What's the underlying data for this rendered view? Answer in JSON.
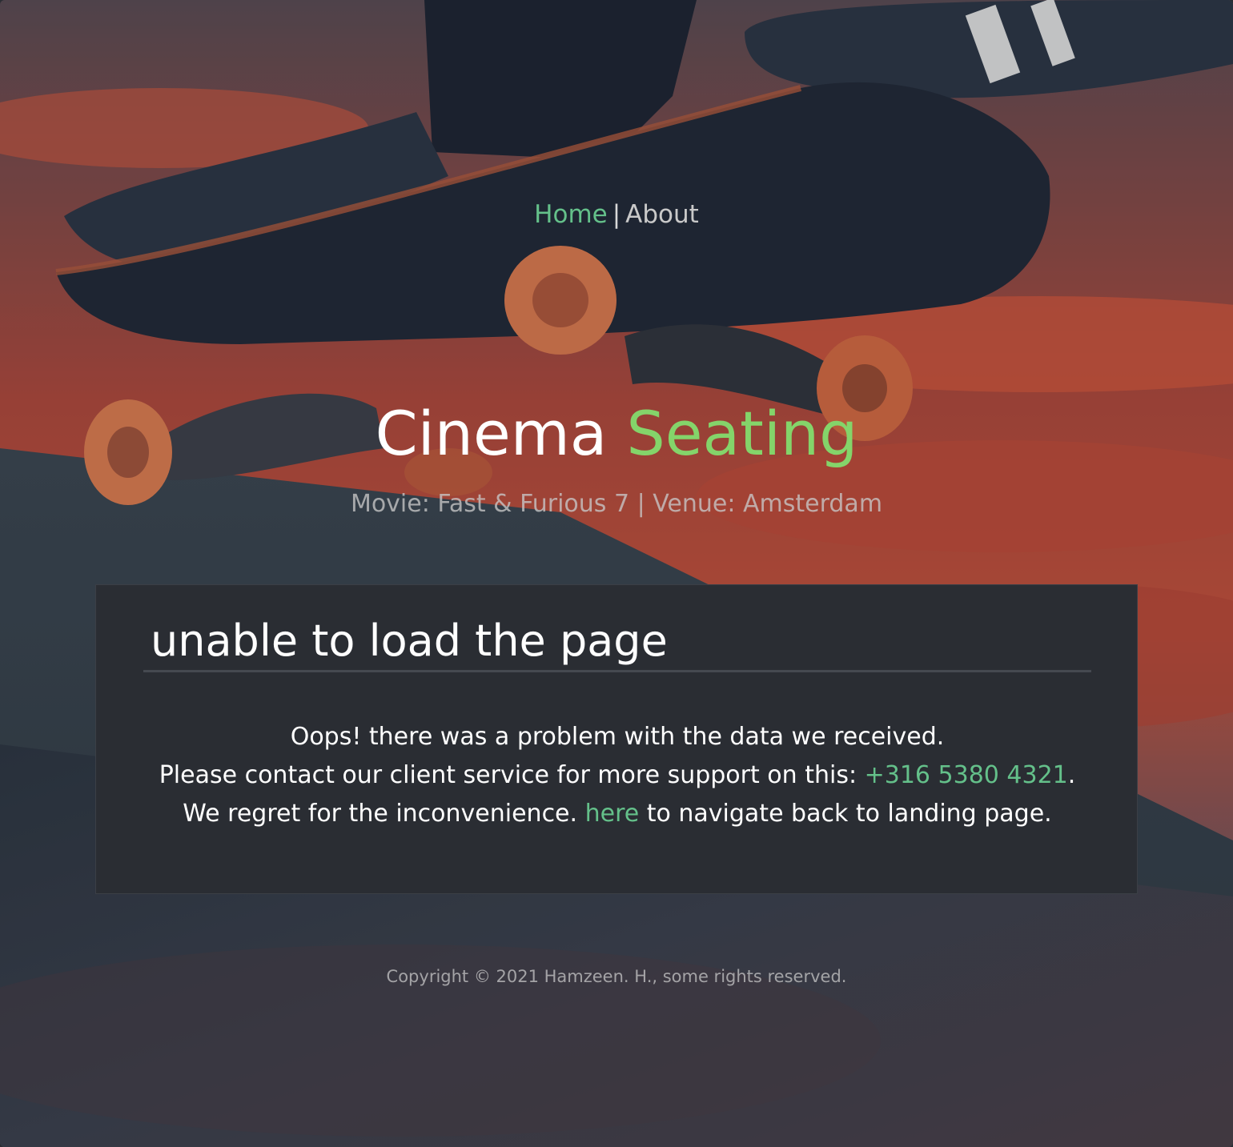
{
  "nav": {
    "home_label": "Home",
    "separator": "|",
    "about_label": "About"
  },
  "hero": {
    "title_part1": "Cinema",
    "title_part2": "Seating",
    "subtitle": "Movie: Fast & Furious 7 | Venue: Amsterdam"
  },
  "error_card": {
    "heading": "unable to load the page",
    "line1": "Oops! there was a problem with the data we received.",
    "line2_prefix": "Please contact our client service for more support on this: ",
    "phone": "+316 5380 4321",
    "line2_suffix": ".",
    "line3_prefix": "We regret for the inconvenience. ",
    "here_link": "here",
    "line3_suffix": " to navigate back to landing page."
  },
  "footer": {
    "copyright": "Copyright © 2021 Hamzeen. H., some rights reserved."
  },
  "colors": {
    "accent_green": "#64c08a",
    "title_green": "#84d46a",
    "card_bg": "#2a2d33"
  }
}
